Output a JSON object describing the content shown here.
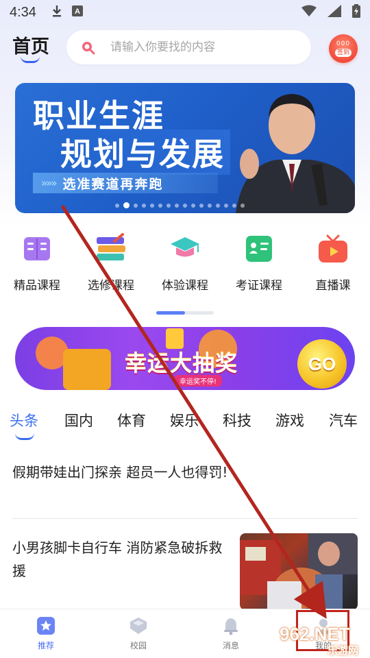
{
  "status_bar": {
    "time": "4:34"
  },
  "header": {
    "title": "首页",
    "search_placeholder": "请输入你要找的内容",
    "signin_label": "签到",
    "signin_dots": "000"
  },
  "banner": {
    "line1": "职业生涯",
    "line2": "规划与发展",
    "line3": "选准赛道再奔跑",
    "arrows": "»»»",
    "slide_count": 16,
    "active_slide": 2
  },
  "categories": [
    {
      "label": "精品课程",
      "icon": "book-icon"
    },
    {
      "label": "选修课程",
      "icon": "stack-books-icon"
    },
    {
      "label": "体验课程",
      "icon": "graduation-cap-icon"
    },
    {
      "label": "考证课程",
      "icon": "certificate-icon"
    },
    {
      "label": "直播课",
      "icon": "live-tv-icon"
    }
  ],
  "lottery": {
    "title": "幸运大抽奖",
    "subtitle": "幸运奖不停!",
    "go_label": "GO"
  },
  "news_tabs": [
    "头条",
    "国内",
    "体育",
    "娱乐",
    "科技",
    "游戏",
    "汽车"
  ],
  "articles": [
    {
      "title": "假期带娃出门探亲  超员一人也得罚!"
    },
    {
      "title": "小男孩脚卡自行车  消防紧急破拆救援"
    }
  ],
  "bottom_nav": [
    {
      "label": "推荐",
      "icon": "star-icon",
      "active": true
    },
    {
      "label": "校园",
      "icon": "school-icon",
      "active": false
    },
    {
      "label": "消息",
      "icon": "bell-icon",
      "active": false
    },
    {
      "label": "我的",
      "icon": "user-icon",
      "active": false
    }
  ],
  "watermark": {
    "main": "962.NET",
    "sub": "乐游网"
  },
  "colors": {
    "accent": "#3a6df0",
    "annotation_red": "#c0221c",
    "banner_blue": "#1f5fc9",
    "lottery_purple": "#8a3fe8"
  }
}
